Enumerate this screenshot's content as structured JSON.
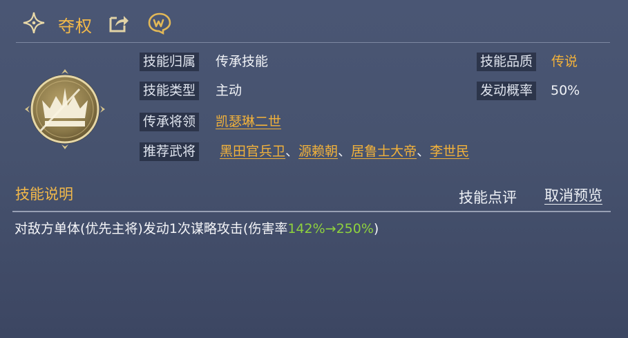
{
  "header": {
    "skill_name": "夺权"
  },
  "info": {
    "ownership_label": "技能归属",
    "ownership_value": "传承技能",
    "type_label": "技能类型",
    "type_value": "主动",
    "inherit_label": "传承将领",
    "inherit_value": "凯瑟琳二世",
    "recommend_label": "推荐武将",
    "recommended": [
      "黑田官兵卫",
      "源赖朝",
      "居鲁士大帝",
      "李世民"
    ],
    "separator": "、",
    "quality_label": "技能品质",
    "quality_value": "传说",
    "chance_label": "发动概率",
    "chance_value": "50%"
  },
  "description": {
    "title": "技能说明",
    "review_button": "技能点评",
    "cancel_preview_button": "取消预览",
    "text_prefix": "对敌方单体(优先主将)发动1次谋略攻击(伤害率",
    "damage_range": "142%→250%",
    "text_suffix": ")"
  },
  "colors": {
    "gold": "#f3b23a",
    "green": "#8fd23d",
    "panel_bg": "#47536f"
  },
  "icons": {
    "header": "four-point-star-icon",
    "share": "share-icon",
    "chat": "chat-bubble-icon",
    "emblem": "crown-emblem-icon"
  }
}
